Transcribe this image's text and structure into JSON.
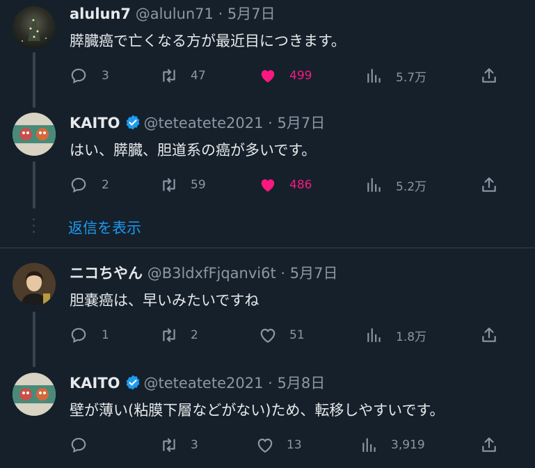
{
  "tweets": [
    {
      "name": "alulun7",
      "handle": "@alulun71 · 5月7日",
      "text": "膵臓癌で亡くなる方が最近目につきます。",
      "verified": false,
      "replies": "3",
      "retweets": "47",
      "likes": "499",
      "liked": true,
      "views": "5.7万"
    },
    {
      "name": "KAITO",
      "handle": "@teteatete2021 · 5月7日",
      "text": "はい、膵臓、胆道系の癌が多いです。",
      "verified": true,
      "replies": "2",
      "retweets": "59",
      "likes": "486",
      "liked": true,
      "views": "5.2万"
    },
    {
      "name": "ニコちやん",
      "handle": "@B3ldxfFjqanvi6t · 5月7日",
      "text": "胆嚢癌は、早いみたいですね",
      "verified": false,
      "replies": "1",
      "retweets": "2",
      "likes": "51",
      "liked": false,
      "views": "1.8万"
    },
    {
      "name": "KAITO",
      "handle": "@teteatete2021 · 5月8日",
      "text": "壁が薄い(粘膜下層などがない)ため、転移しやすいです。",
      "verified": true,
      "replies": "",
      "retweets": "3",
      "likes": "13",
      "liked": false,
      "views": "3,919"
    }
  ],
  "show_replies_label": "返信を表示",
  "colors": {
    "background": "#15202b",
    "like_active": "#f91880",
    "link": "#1d9bf0",
    "muted": "#8b98a5",
    "verified": "#1d9bf0"
  }
}
